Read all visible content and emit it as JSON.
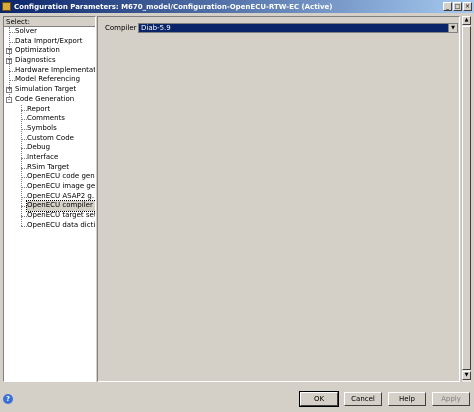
{
  "window": {
    "title": "Configuration Parameters: M670_model/Configuration-OpenECU-RTW-EC (Active)",
    "min_label": "_",
    "max_label": "□",
    "close_label": "×"
  },
  "tree": {
    "select_label": "Select:",
    "items": [
      {
        "label": "Solver",
        "indent": 0,
        "expander": ""
      },
      {
        "label": "Data Import/Export",
        "indent": 0,
        "expander": ""
      },
      {
        "label": "Optimization",
        "indent": 0,
        "expander": "+"
      },
      {
        "label": "Diagnostics",
        "indent": 0,
        "expander": "+"
      },
      {
        "label": "Hardware Implementat...",
        "indent": 0,
        "expander": ""
      },
      {
        "label": "Model Referencing",
        "indent": 0,
        "expander": ""
      },
      {
        "label": "Simulation Target",
        "indent": 0,
        "expander": "+"
      },
      {
        "label": "Code Generation",
        "indent": 0,
        "expander": "-"
      },
      {
        "label": "Report",
        "indent": 1,
        "expander": ""
      },
      {
        "label": "Comments",
        "indent": 1,
        "expander": ""
      },
      {
        "label": "Symbols",
        "indent": 1,
        "expander": ""
      },
      {
        "label": "Custom Code",
        "indent": 1,
        "expander": ""
      },
      {
        "label": "Debug",
        "indent": 1,
        "expander": ""
      },
      {
        "label": "Interface",
        "indent": 1,
        "expander": ""
      },
      {
        "label": "RSim Target",
        "indent": 1,
        "expander": ""
      },
      {
        "label": "OpenECU code gen...",
        "indent": 1,
        "expander": ""
      },
      {
        "label": "OpenECU image ge...",
        "indent": 1,
        "expander": ""
      },
      {
        "label": "OpenECU ASAP2 g...",
        "indent": 1,
        "expander": ""
      },
      {
        "label": "OpenECU compiler ...",
        "indent": 1,
        "expander": "",
        "selected": true
      },
      {
        "label": "OpenECU target set...",
        "indent": 1,
        "expander": ""
      },
      {
        "label": "OpenECU data dicti...",
        "indent": 1,
        "expander": ""
      }
    ]
  },
  "compiler": {
    "label": "Compiler",
    "value": "Diab-5.9"
  },
  "buttons": {
    "ok": "OK",
    "cancel": "Cancel",
    "help": "Help",
    "apply": "Apply"
  }
}
